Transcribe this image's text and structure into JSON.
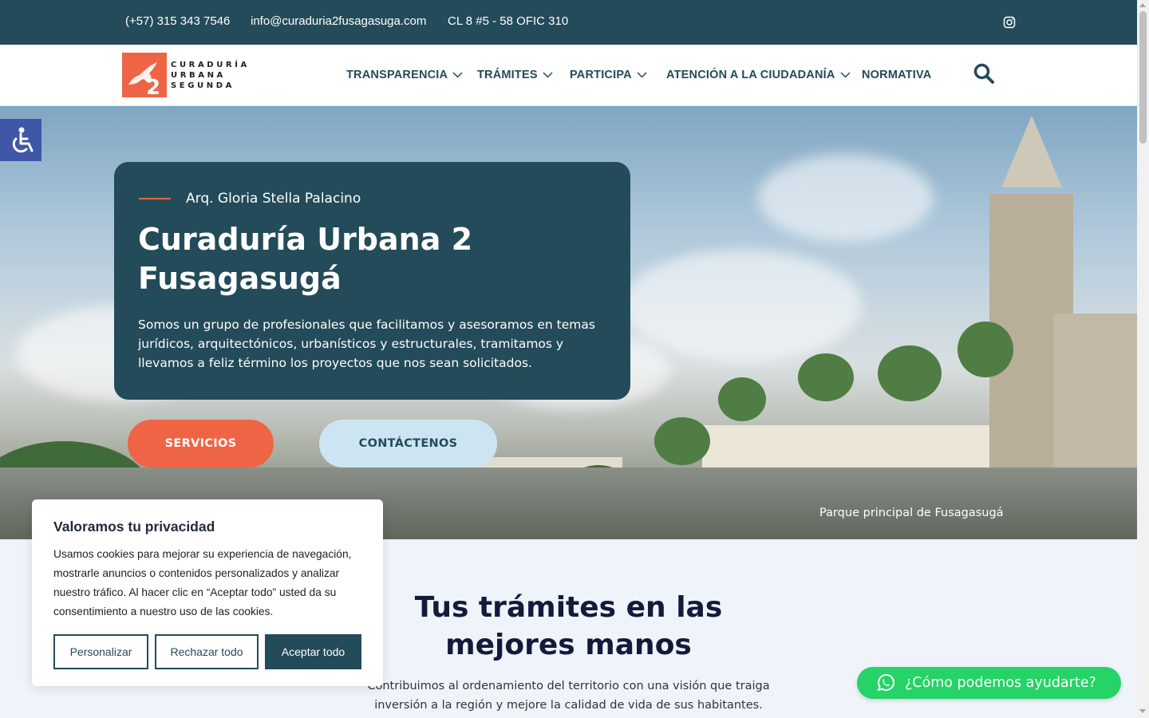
{
  "topbar": {
    "phone": "(+57) 315 343 7546",
    "email": "info@curaduria2fusagasuga.com",
    "address": "CL 8 #5 - 58 OFIC 310",
    "social_icon": "instagram-icon"
  },
  "header": {
    "logo_line1": "CURADURÍA",
    "logo_line2": "URBANA",
    "logo_line3": "SEGUNDA",
    "logo_numeral": "2",
    "nav": [
      {
        "label": "TRANSPARENCIA",
        "has_dropdown": true
      },
      {
        "label": "TRÁMITES",
        "has_dropdown": true
      },
      {
        "label": "PARTICIPA",
        "has_dropdown": true
      },
      {
        "label": "ATENCIÓN A LA CIUDADANÍA",
        "has_dropdown": true
      },
      {
        "label": "NORMATIVA",
        "has_dropdown": false
      }
    ],
    "search_icon": "search-icon"
  },
  "hero": {
    "subtitle": "Arq. Gloria Stella Palacino",
    "title": "Curaduría Urbana 2 Fusagasugá",
    "description": "Somos un grupo de profesionales que facilitamos y asesoramos en temas jurídicos, arquitectónicos, urbanísticos y estructurales, tramitamos y llevamos a feliz término los proyectos que nos sean solicitados.",
    "btn_services": "SERVICIOS",
    "btn_contact": "CONTÁCTENOS",
    "caption": "Parque principal de Fusagasugá"
  },
  "section": {
    "title": "Tus trámites en las mejores manos",
    "description": "Contribuimos al ordenamiento del territorio con una visión que traiga inversión a la región y mejore la calidad de vida de sus habitantes."
  },
  "cookie": {
    "title": "Valoramos tu privacidad",
    "text": "Usamos cookies para mejorar su experiencia de navegación, mostrarle anuncios o contenidos personalizados y analizar nuestro tráfico. Al hacer clic en “Aceptar todo” usted da su consentimiento a nuestro uso de las cookies.",
    "customize": "Personalizar",
    "reject": "Rechazar todo",
    "accept": "Aceptar todo"
  },
  "whatsapp": {
    "label": "¿Cómo podemos ayudarte?"
  },
  "colors": {
    "primary": "#234b59",
    "accent": "#ee6444",
    "light": "#cde5f2",
    "whatsapp": "#25d366",
    "accessibility": "#3e57a6"
  }
}
